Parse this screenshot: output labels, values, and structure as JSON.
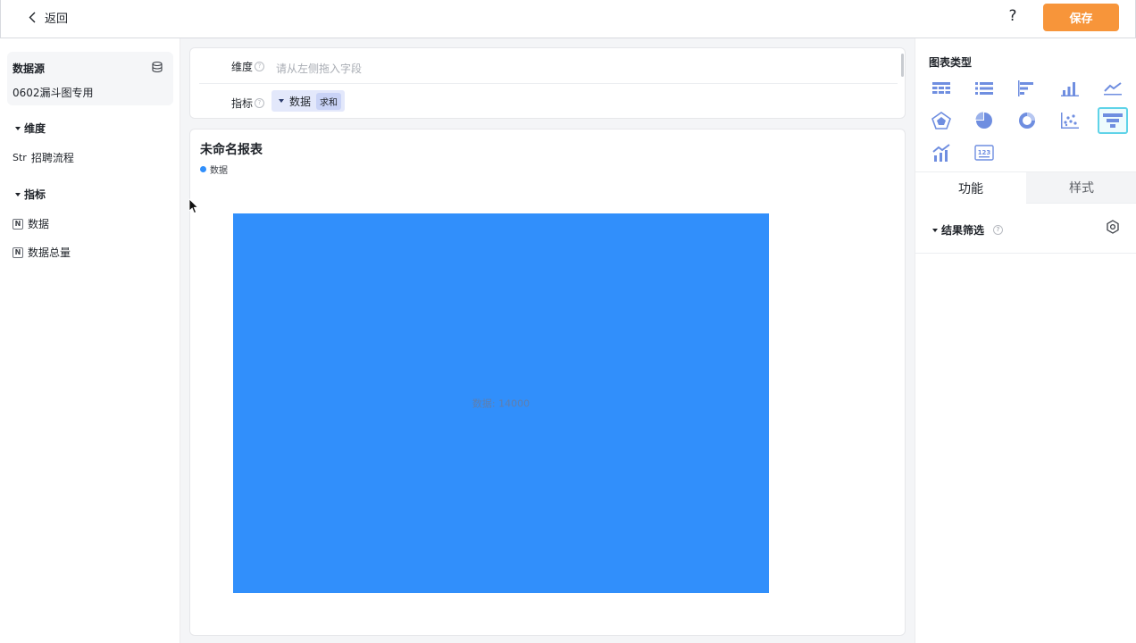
{
  "header": {
    "back_label": "返回",
    "help_label": "?",
    "save_label": "保存"
  },
  "datasource": {
    "title": "数据源",
    "name": "0602漏斗图专用"
  },
  "dimensions": {
    "title": "维度",
    "fields": [
      {
        "type_tag": "Str",
        "name": "招聘流程"
      }
    ]
  },
  "measures": {
    "title": "指标",
    "fields": [
      {
        "type_tag": "N",
        "name": "数据"
      },
      {
        "type_tag": "N",
        "name": "数据总量"
      }
    ]
  },
  "config": {
    "dimension_label": "维度",
    "dimension_placeholder": "请从左侧拖入字段",
    "measure_label": "指标",
    "measure_chip": {
      "name": "数据",
      "aggregation": "求和"
    }
  },
  "report": {
    "title": "未命名报表"
  },
  "chart_data": {
    "type": "funnel",
    "legend": [
      {
        "name": "数据",
        "color": "#318ffb"
      }
    ],
    "series": [
      {
        "name": "数据",
        "values": [
          14000
        ]
      }
    ],
    "data_labels": [
      "数据: 14000"
    ],
    "color": "#318ffb"
  },
  "right_panel": {
    "chart_type_title": "图表类型",
    "chart_types": [
      {
        "icon": "table-icon",
        "active": false
      },
      {
        "icon": "detail-list-icon",
        "active": false
      },
      {
        "icon": "horizontal-bar-icon",
        "active": false
      },
      {
        "icon": "column-chart-icon",
        "active": false
      },
      {
        "icon": "line-chart-icon",
        "active": false
      },
      {
        "icon": "radar-chart-icon",
        "active": false
      },
      {
        "icon": "pie-chart-icon",
        "active": false
      },
      {
        "icon": "donut-chart-icon",
        "active": false
      },
      {
        "icon": "scatter-chart-icon",
        "active": false
      },
      {
        "icon": "funnel-chart-icon",
        "active": true
      },
      {
        "icon": "combo-chart-icon",
        "active": false
      },
      {
        "icon": "indicator-card-icon",
        "active": false
      }
    ],
    "tabs": [
      "功能",
      "样式"
    ],
    "filter_label": "结果筛选"
  },
  "colors": {
    "accent": "#f7953a",
    "chart_blue": "#318ffb",
    "icon_blue": "#6f8ee0",
    "active_border": "#5fd3e8"
  }
}
